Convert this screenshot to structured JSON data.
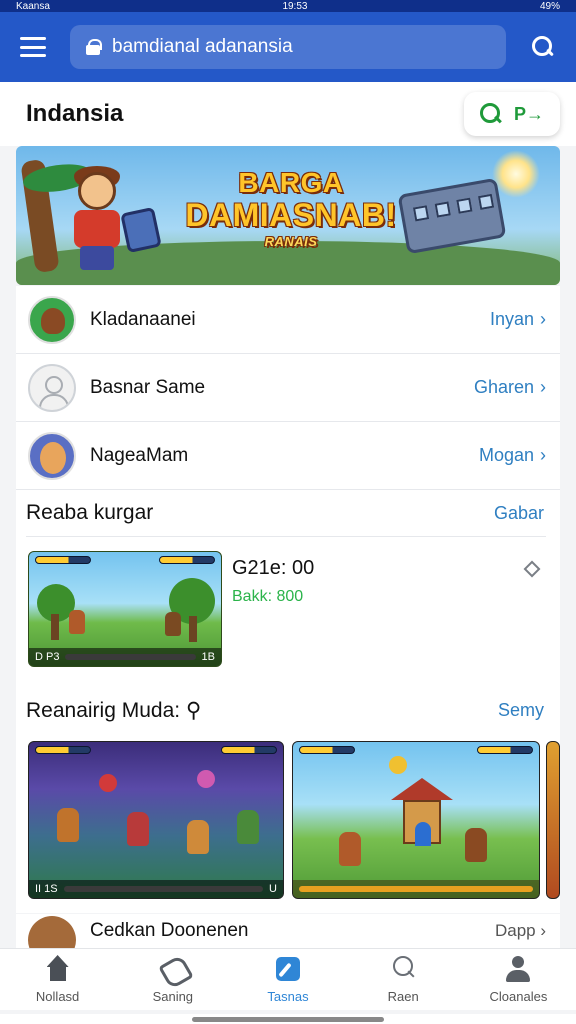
{
  "status_bar": {
    "carrier": "Kaansa",
    "time": "19:53",
    "battery": "49%"
  },
  "app_bar": {
    "url": "bamdianal adanansia"
  },
  "page": {
    "title": "Indansia",
    "action_arrow": "P→"
  },
  "banner": {
    "line1": "BARGA",
    "line2": "DAMIASNAB!",
    "sub": "RANAIS"
  },
  "users": [
    {
      "name": "Kladanaanei",
      "link": "Inyan"
    },
    {
      "name": "Basnar Same",
      "link": "Gharen"
    },
    {
      "name": "NageaMam",
      "link": "Mogan"
    }
  ],
  "section1": {
    "title": "Reaba kurgar",
    "link": "Gabar"
  },
  "game": {
    "stat": "G21e: 00",
    "sub": "Bakk: 800",
    "thumb_label_left": "D P3",
    "thumb_label_right": "1B"
  },
  "section2": {
    "title": "Reanairig Muda:",
    "link": "Semy"
  },
  "gallery": {
    "left_label": "II 1S",
    "right_label": "U"
  },
  "partial_row": {
    "name": "Cedkan Doonenen",
    "link": "Dapp"
  },
  "nav": [
    {
      "label": "Nollasd",
      "icon": "home-icon"
    },
    {
      "label": "Saning",
      "icon": "tag-icon"
    },
    {
      "label": "Tasnas",
      "icon": "pen-icon"
    },
    {
      "label": "Raen",
      "icon": "search-icon"
    },
    {
      "label": "Cloanales",
      "icon": "user-icon"
    }
  ],
  "colors": {
    "app_bar": "#2458c8",
    "accent": "#2f86d6",
    "link": "#2f7fc1",
    "green": "#2bb34a"
  }
}
